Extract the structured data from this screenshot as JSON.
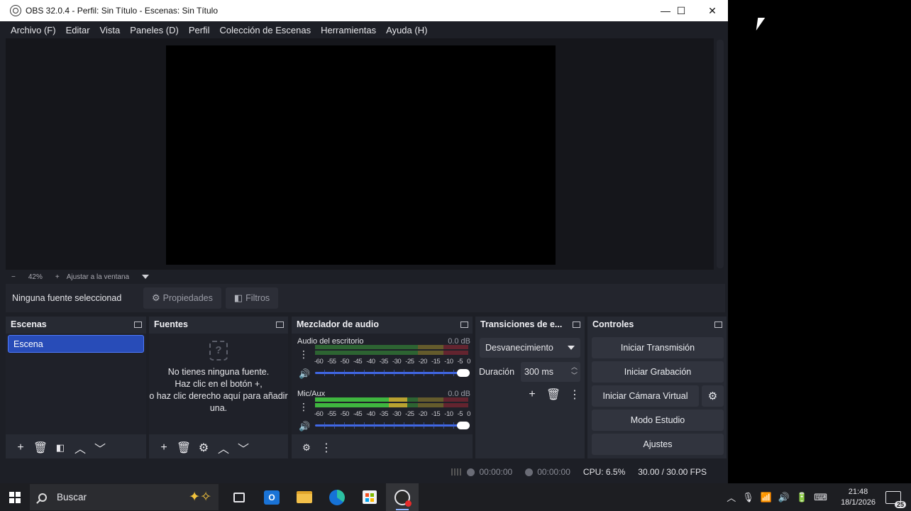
{
  "window": {
    "title": "OBS 32.0.4 - Perfil: Sin Título - Escenas: Sin Título",
    "minimize_glyph": "—",
    "maximize_glyph": "☐",
    "close_glyph": "✕"
  },
  "menubar": [
    "Archivo (F)",
    "Editar",
    "Vista",
    "Paneles (D)",
    "Perfil",
    "Colección de Escenas",
    "Herramientas",
    "Ayuda (H)"
  ],
  "zoombar": {
    "minus": "−",
    "zoom": "42%",
    "plus": "+",
    "fit": "Ajustar a la ventana"
  },
  "sourcebar": {
    "no_selection": "Ninguna fuente seleccionad",
    "properties": "Propiedades",
    "filters": "Filtros"
  },
  "scenes": {
    "title": "Escenas",
    "items": [
      "Escena"
    ]
  },
  "sources": {
    "title": "Fuentes",
    "empty_line1": "No tienes ninguna fuente.",
    "empty_line2": "Haz clic en el botón +,",
    "empty_line3": "o haz clic derecho aquí para añadir",
    "empty_line4": "una."
  },
  "mixer": {
    "title": "Mezclador de audio",
    "channels": [
      {
        "name": "Audio del escritorio",
        "db": "0.0 dB",
        "level": 0
      },
      {
        "name": "Mic/Aux",
        "db": "0.0 dB",
        "level": 0.6
      }
    ],
    "scale": [
      "-60",
      "-55",
      "-50",
      "-45",
      "-40",
      "-35",
      "-30",
      "-25",
      "-20",
      "-15",
      "-10",
      "-5",
      "0"
    ],
    "volume": 1.0
  },
  "transitions": {
    "title": "Transiciones de e...",
    "selected": "Desvanecimiento",
    "duration_label": "Duración",
    "duration_value": "300 ms"
  },
  "controls": {
    "title": "Controles",
    "start_stream": "Iniciar Transmisión",
    "start_record": "Iniciar Grabación",
    "start_virtualcam": "Iniciar Cámara Virtual",
    "studio_mode": "Modo Estudio",
    "settings": "Ajustes"
  },
  "status": {
    "stream_time": "00:00:00",
    "record_time": "00:00:00",
    "cpu": "CPU: 6.5%",
    "fps": "30.00 / 30.00 FPS"
  },
  "taskbar": {
    "search_placeholder": "Buscar",
    "time": "21:48",
    "date": "18/1/2026",
    "notification_count": "25"
  },
  "colors": {
    "accent": "#284cb8",
    "meter_green": "#3fb63f",
    "meter_yellow": "#b9a230",
    "meter_red": "#b62838"
  }
}
